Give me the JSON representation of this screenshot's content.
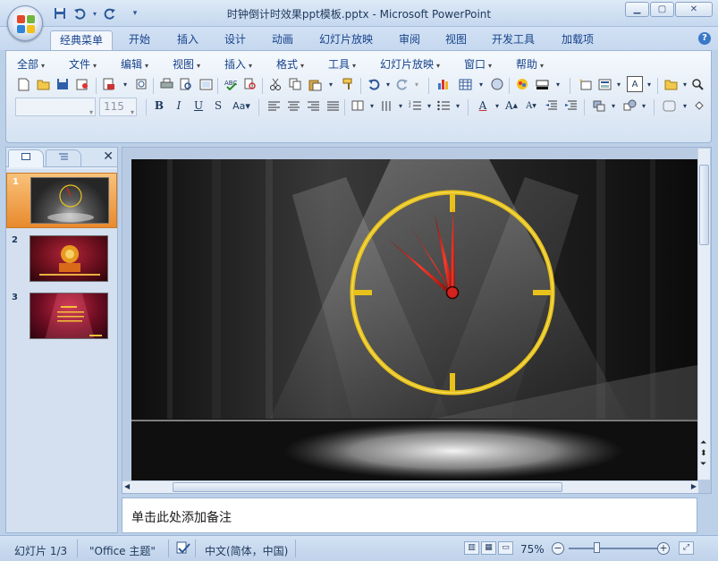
{
  "window": {
    "title": "时钟倒计时效果ppt模板.pptx - Microsoft PowerPoint",
    "controls": [
      "minimize",
      "maximize",
      "close"
    ]
  },
  "quick_access": [
    "save-icon",
    "undo-icon",
    "redo-icon",
    "customize-icon"
  ],
  "ribbon_tabs": [
    {
      "label": "经典菜单",
      "active": true
    },
    {
      "label": "开始"
    },
    {
      "label": "插入"
    },
    {
      "label": "设计"
    },
    {
      "label": "动画"
    },
    {
      "label": "幻灯片放映"
    },
    {
      "label": "审阅"
    },
    {
      "label": "视图"
    },
    {
      "label": "开发工具"
    },
    {
      "label": "加载项"
    }
  ],
  "menus": [
    {
      "label": "全部"
    },
    {
      "label": "文件"
    },
    {
      "label": "编辑"
    },
    {
      "label": "视图"
    },
    {
      "label": "插入"
    },
    {
      "label": "格式"
    },
    {
      "label": "工具"
    },
    {
      "label": "幻灯片放映"
    },
    {
      "label": "窗口"
    },
    {
      "label": "帮助"
    }
  ],
  "font": {
    "name": "",
    "size": "115"
  },
  "left_pane": {
    "tabs": [
      "slides-tab",
      "outline-tab"
    ],
    "slides": [
      {
        "number": "1",
        "selected": true
      },
      {
        "number": "2"
      },
      {
        "number": "3"
      }
    ]
  },
  "notes": {
    "placeholder": "单击此处添加备注"
  },
  "status": {
    "slide_info": "幻灯片 1/3",
    "theme": "\"Office 主题\"",
    "language": "中文(简体，中国)",
    "zoom": "75%"
  },
  "colors": {
    "clock_ring": "#e8c21a",
    "hands": "#d2231c",
    "selected_thumb": "#f0a24a"
  }
}
